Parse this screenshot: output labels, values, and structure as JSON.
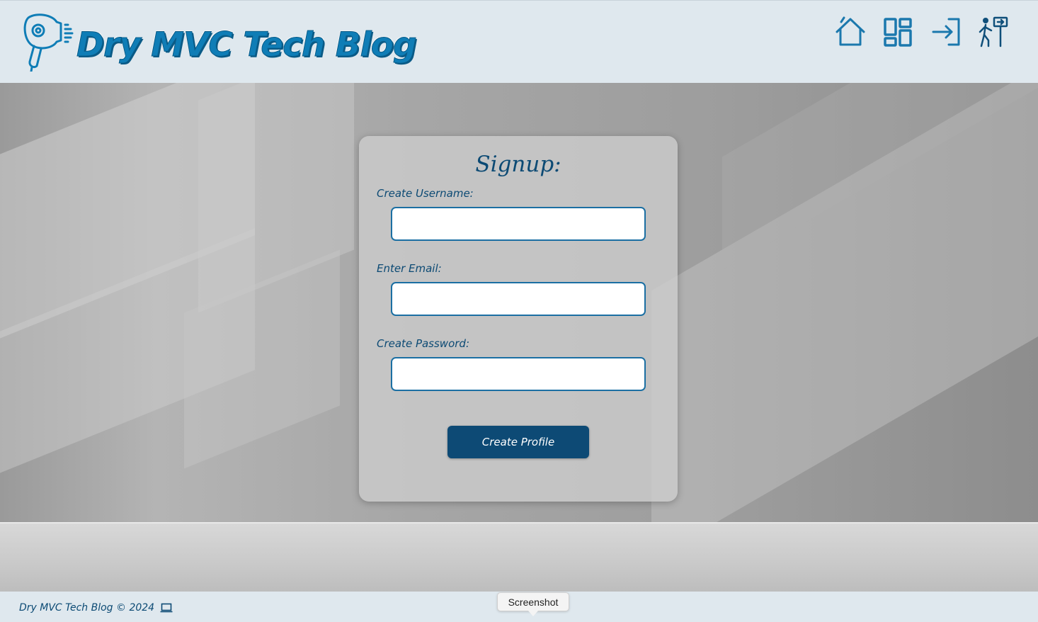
{
  "header": {
    "logo_text": "Dry MVC Tech Blog",
    "logo_icon": "hair-dryer-icon",
    "nav": [
      {
        "name": "home",
        "icon": "home-icon"
      },
      {
        "name": "dashboard",
        "icon": "dashboard-grid-icon"
      },
      {
        "name": "login",
        "icon": "login-arrow-icon"
      },
      {
        "name": "signup",
        "icon": "signup-person-icon"
      }
    ]
  },
  "signup": {
    "title": "Signup:",
    "username_label": "Create Username:",
    "username_value": "",
    "email_label": "Enter Email:",
    "email_value": "",
    "password_label": "Create Password:",
    "password_value": "",
    "submit_label": "Create Profile"
  },
  "footer": {
    "text": "Dry MVC Tech Blog © 2024",
    "icon": "laptop-icon"
  },
  "tooltip": {
    "text": "Screenshot"
  },
  "colors": {
    "brand": "#0f7db6",
    "brand_dark": "#0d4a75",
    "header_bg": "#dfe8ee"
  }
}
